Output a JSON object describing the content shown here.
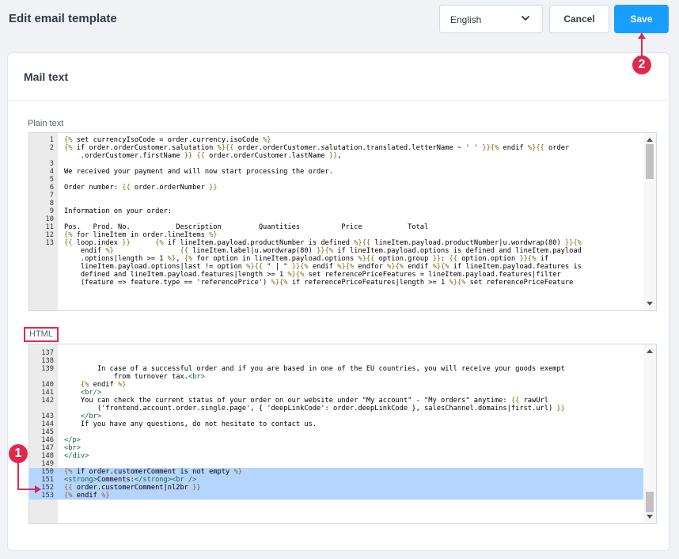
{
  "header": {
    "title": "Edit email template",
    "language_value": "English",
    "cancel_label": "Cancel",
    "save_label": "Save"
  },
  "card": {
    "title": "Mail text",
    "plain_text_label": "Plain text",
    "html_label": "HTML"
  },
  "markers": {
    "m1": "1",
    "m2": "2"
  },
  "plain_editor": {
    "lines": [
      {
        "n": "1",
        "t": "{% set currencyIsoCode = order.currency.isoCode %}"
      },
      {
        "n": "2",
        "t": "{% if order.orderCustomer.salutation %}{{ order.orderCustomer.salutation.translated.letterName ~ ' ' }}{% endif %}{{ order"
      },
      {
        "n": "",
        "t": "    .orderCustomer.firstName }} {{ order.orderCustomer.lastName }},"
      },
      {
        "n": "3",
        "t": ""
      },
      {
        "n": "4",
        "t": "We received your payment and will now start processing the order."
      },
      {
        "n": "5",
        "t": ""
      },
      {
        "n": "6",
        "t": "Order number: {{ order.orderNumber }}"
      },
      {
        "n": "7",
        "t": ""
      },
      {
        "n": "8",
        "t": ""
      },
      {
        "n": "9",
        "t": "Information on your order:"
      },
      {
        "n": "10",
        "t": ""
      },
      {
        "n": "11",
        "t": "Pos.   Prod. No.           Description         Quantities          Price           Total"
      },
      {
        "n": "12",
        "t": "{% for lineItem in order.lineItems %}"
      },
      {
        "n": "13",
        "t": "{{ loop.index }}      {% if lineItem.payload.productNumber is defined %}{{ lineItem.payload.productNumber|u.wordwrap(80) }}{%"
      },
      {
        "n": "",
        "t": "    endif %}                {{ lineItem.label|u.wordwrap(80) }}{% if lineItem.payload.options is defined and lineItem.payload"
      },
      {
        "n": "",
        "t": "    .options|length >= 1 %}, {% for option in lineItem.payload.options %}{{ option.group }}: {{ option.option }}{% if"
      },
      {
        "n": "",
        "t": "    lineItem.payload.options|last != option %}{{ \" | \" }}{% endif %}{% endfor %}{% endif %}{% if lineItem.payload.features is"
      },
      {
        "n": "",
        "t": "    defined and lineItem.payload.features|length >= 1 %}{% set referencePriceFeatures = lineItem.payload.features|filter"
      },
      {
        "n": "",
        "t": "    (feature => feature.type == 'referencePrice') %}{% if referencePriceFeatures|length >= 1 %}{% set referencePriceFeature"
      }
    ]
  },
  "html_editor": {
    "lines": [
      {
        "n": "137",
        "t": "",
        "hl": false
      },
      {
        "n": "138",
        "t": "",
        "hl": false
      },
      {
        "n": "139",
        "t": "        In case of a successful order and if you are based in one of the EU countries, you will receive your goods exempt",
        "hl": false
      },
      {
        "n": "",
        "t": "            from turnover tax.<br>",
        "hl": false
      },
      {
        "n": "140",
        "t": "    {% endif %}",
        "hl": false
      },
      {
        "n": "141",
        "t": "    <br/>",
        "hl": false
      },
      {
        "n": "142",
        "t": "    You can check the current status of your order on our website under \"My account\" - \"My orders\" anytime: {{ rawUrl",
        "hl": false
      },
      {
        "n": "",
        "t": "        ('frontend.account.order.single.page', { 'deepLinkCode': order.deepLinkCode }, salesChannel.domains|first.url) }}",
        "hl": false
      },
      {
        "n": "143",
        "t": "    </br>",
        "hl": false
      },
      {
        "n": "144",
        "t": "    If you have any questions, do not hesitate to contact us.",
        "hl": false
      },
      {
        "n": "145",
        "t": "",
        "hl": false
      },
      {
        "n": "146",
        "t": "</p>",
        "hl": false
      },
      {
        "n": "147",
        "t": "<br>",
        "hl": false
      },
      {
        "n": "148",
        "t": "</div>",
        "hl": false
      },
      {
        "n": "149",
        "t": "",
        "hl": false
      },
      {
        "n": "150",
        "t": "{% if order.customerComment is not empty %}",
        "hl": true
      },
      {
        "n": "151",
        "t": "<strong>Comments:</strong><br />",
        "hl": true
      },
      {
        "n": "152",
        "t": "{{ order.customerComment|nl2br }}",
        "hl": true
      },
      {
        "n": "153",
        "t": "{% endif %}",
        "hl": true
      }
    ]
  }
}
